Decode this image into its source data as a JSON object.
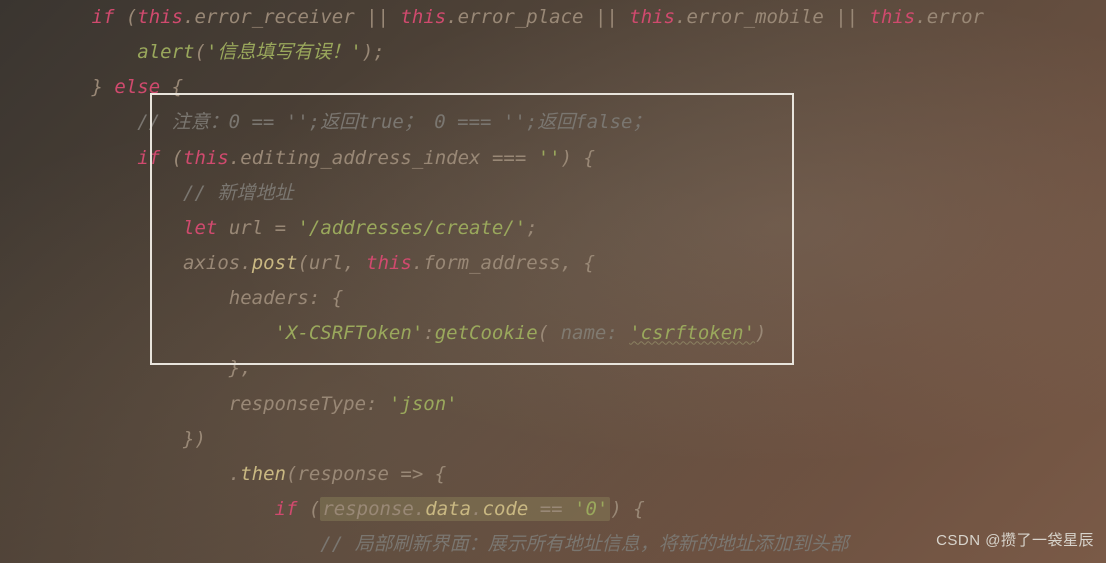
{
  "code": {
    "line1": {
      "if": "if",
      "p1": " (",
      "this1": "this",
      "dot1": ".",
      "prop1": "error_receiver",
      "or1": " || ",
      "this2": "this",
      "dot2": ".",
      "prop2": "error_place",
      "or2": " || ",
      "this3": "this",
      "dot3": ".",
      "prop3": "error_mobile",
      "or3": " || ",
      "this4": "this",
      "dot4": ".",
      "prop4": "error"
    },
    "line2": {
      "func": "alert",
      "p1": "(",
      "str": "'信息填写有误！'",
      "p2": ");"
    },
    "line3": {
      "brace1": "}",
      "else": " else ",
      "brace2": "{"
    },
    "line4": {
      "comment": "// 注意：0 == '';返回true； 0 === '';返回false；"
    },
    "line5": {
      "if": "if",
      "p1": " (",
      "this": "this",
      "dot": ".",
      "prop": "editing_address_index",
      "eq": " === ",
      "str": "''",
      "p2": ") {"
    },
    "line6": {
      "comment": "// 新增地址"
    },
    "line7": {
      "let": "let",
      "sp": " ",
      "var": "url",
      "eq": " = ",
      "str": "'/addresses/create/'",
      "semi": ";"
    },
    "line8": {
      "obj": "axios",
      "dot": ".",
      "method": "post",
      "p1": "(",
      "arg1": "url",
      "comma1": ", ",
      "this": "this",
      "dot2": ".",
      "prop": "form_address",
      "comma2": ", {"
    },
    "line9": {
      "key": "headers",
      "colon": ": {"
    },
    "line10": {
      "key": "'X-CSRFToken'",
      "colon": ":",
      "func": "getCookie",
      "p1": "(",
      "hint": " name: ",
      "str": "'csrftoken'",
      "p2": ")"
    },
    "line11": {
      "close": "},"
    },
    "line12": {
      "key": "responseType",
      "colon": ": ",
      "str": "'json'"
    },
    "line13": {
      "close": "})"
    },
    "line14": {
      "dot": ".",
      "method": "then",
      "p1": "(",
      "param": "response",
      "arrow": " => {"
    },
    "line15": {
      "if": "if",
      "p1": " (",
      "obj": "response",
      "dot1": ".",
      "prop1": "data",
      "dot2": ".",
      "prop2": "code",
      "eq": " == ",
      "str": "'0'",
      "p2": ") {"
    },
    "line16": {
      "comment": "// 局部刷新界面：展示所有地址信息，将新的地址添加到头部"
    }
  },
  "watermark": "CSDN @攒了一袋星辰"
}
